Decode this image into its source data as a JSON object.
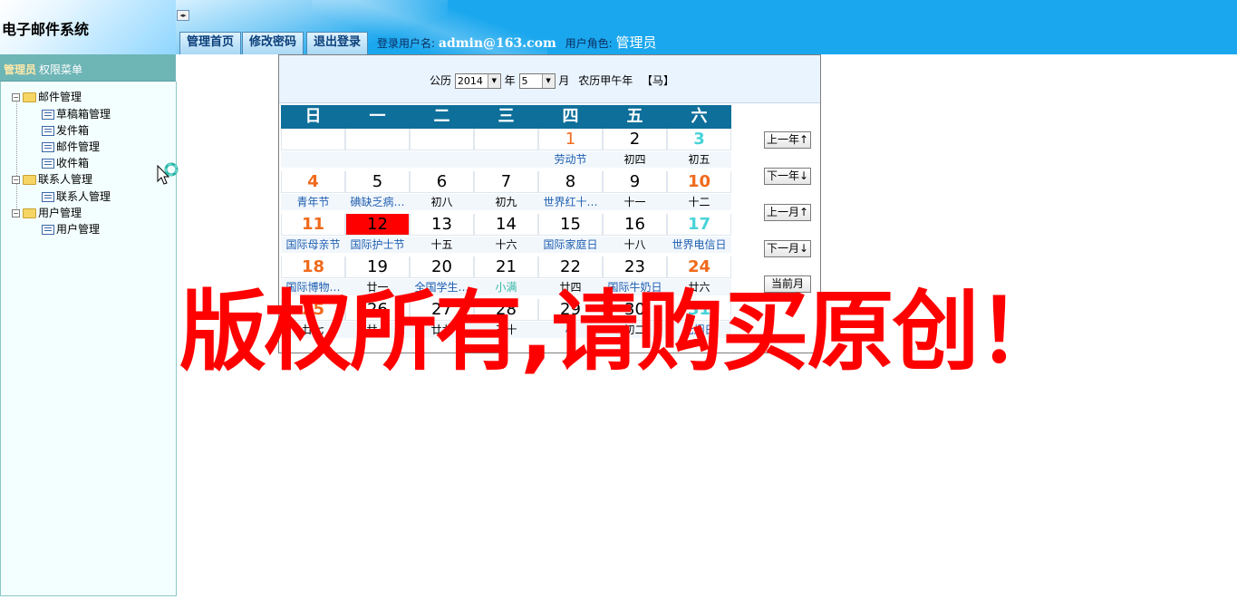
{
  "header": {
    "app_title": "电子邮件系统",
    "tabs": [
      "管理首页",
      "修改密码",
      "退出登录"
    ],
    "login_label": "登录用户名:",
    "login_user": "admin@163.com",
    "role_label": "用户角色:",
    "role_value": "管理员"
  },
  "sidebar": {
    "role": "管理员",
    "menu_title": "权限菜单",
    "groups": [
      {
        "label": "邮件管理",
        "items": [
          "草稿箱管理",
          "发件箱",
          "邮件管理",
          "收件箱"
        ]
      },
      {
        "label": "联系人管理",
        "items": [
          "联系人管理"
        ]
      },
      {
        "label": "用户管理",
        "items": [
          "用户管理"
        ]
      }
    ]
  },
  "calendar": {
    "solar_label": "公历",
    "year_value": "2014",
    "year_label": "年",
    "month_value": "5",
    "month_label": "月",
    "lunar_text": "农历甲午年",
    "zodiac": "【马】",
    "weekdays": [
      "日",
      "一",
      "二",
      "三",
      "四",
      "五",
      "六"
    ],
    "days": [
      [
        "",
        "",
        "",
        "",
        "1",
        "2",
        "3"
      ],
      [
        "4",
        "5",
        "6",
        "7",
        "8",
        "9",
        "10"
      ],
      [
        "11",
        "12",
        "13",
        "14",
        "15",
        "16",
        "17"
      ],
      [
        "18",
        "19",
        "20",
        "21",
        "22",
        "23",
        "24"
      ],
      [
        "25",
        "26",
        "27",
        "28",
        "29",
        "30",
        "31"
      ]
    ],
    "lunar": [
      [
        "",
        "",
        "",
        "",
        "劳动节",
        "初四",
        "初五"
      ],
      [
        "青年节",
        "碘缺乏病…",
        "初八",
        "初九",
        "世界红十…",
        "十一",
        "十二"
      ],
      [
        "国际母亲节",
        "国际护士节",
        "十五",
        "十六",
        "国际家庭日",
        "十八",
        "世界电信日"
      ],
      [
        "国际博物…",
        "廿一",
        "全国学生…",
        "小满",
        "廿四",
        "国际牛奶日",
        "廿六"
      ],
      [
        "廿七",
        "廿八",
        "廿九",
        "三十",
        "小",
        "初二",
        "无烟日"
      ]
    ],
    "buttons": [
      "上一年↑",
      "下一年↓",
      "上一月↑",
      "下一月↓",
      "当前月"
    ]
  },
  "watermark": "版权所有,请购买原创！",
  "colors": {
    "header_blue": "#1aa7ee",
    "sidebar_teal": "#6eb5b6",
    "calendar_header": "#0e6f9a",
    "today": "#ff0000",
    "holiday": "#f06a1b",
    "saturday": "#47d3d8"
  }
}
